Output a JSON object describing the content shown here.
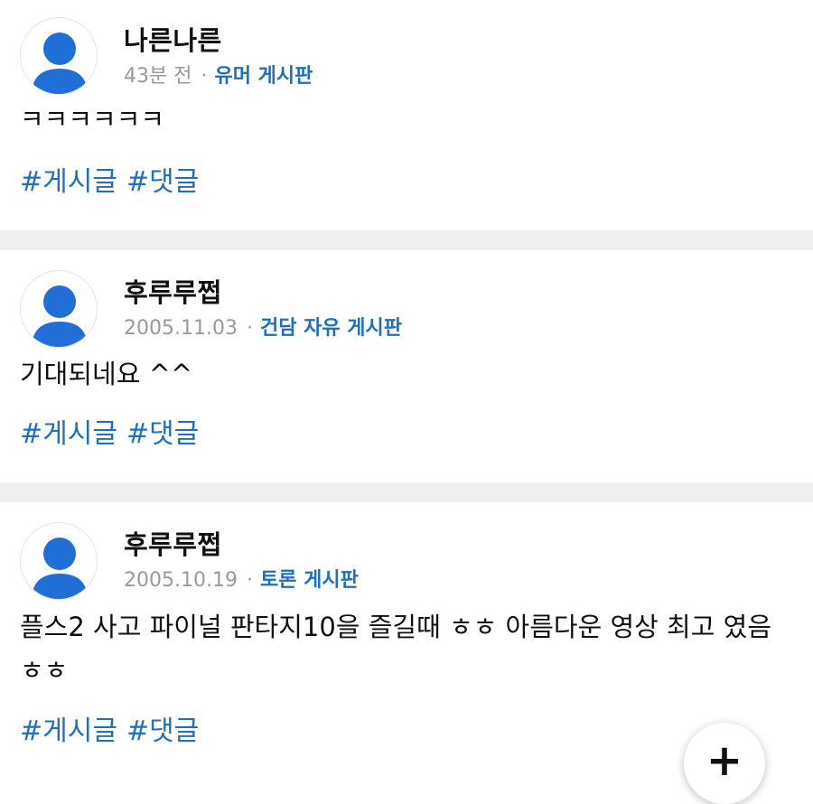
{
  "posts": [
    {
      "username": "나른나른",
      "time": "43분 전",
      "separator": "·",
      "board": "유머 게시판",
      "body": "ㅋㅋㅋㅋㅋㅋ",
      "tags": [
        "#게시글",
        "#댓글"
      ]
    },
    {
      "username": "후루루쩝",
      "time": "2005.11.03",
      "separator": "·",
      "board": "건담 자유 게시판",
      "body": "기대되네요 ^^",
      "tags": [
        "#게시글",
        "#댓글"
      ]
    },
    {
      "username": "후루루쩝",
      "time": "2005.10.19",
      "separator": "·",
      "board": "토론 게시판",
      "body": "플스2 사고 파이널 판타지10을 즐길때 ㅎㅎ 아름다운 영상 최고 였음 ㅎㅎ",
      "tags": [
        "#게시글",
        "#댓글"
      ]
    }
  ],
  "fab": {
    "label": "+",
    "icon": "plus-icon"
  },
  "colors": {
    "accent": "#1f6fbf",
    "avatar": "#1f6fd6",
    "separator": "#efefef"
  }
}
